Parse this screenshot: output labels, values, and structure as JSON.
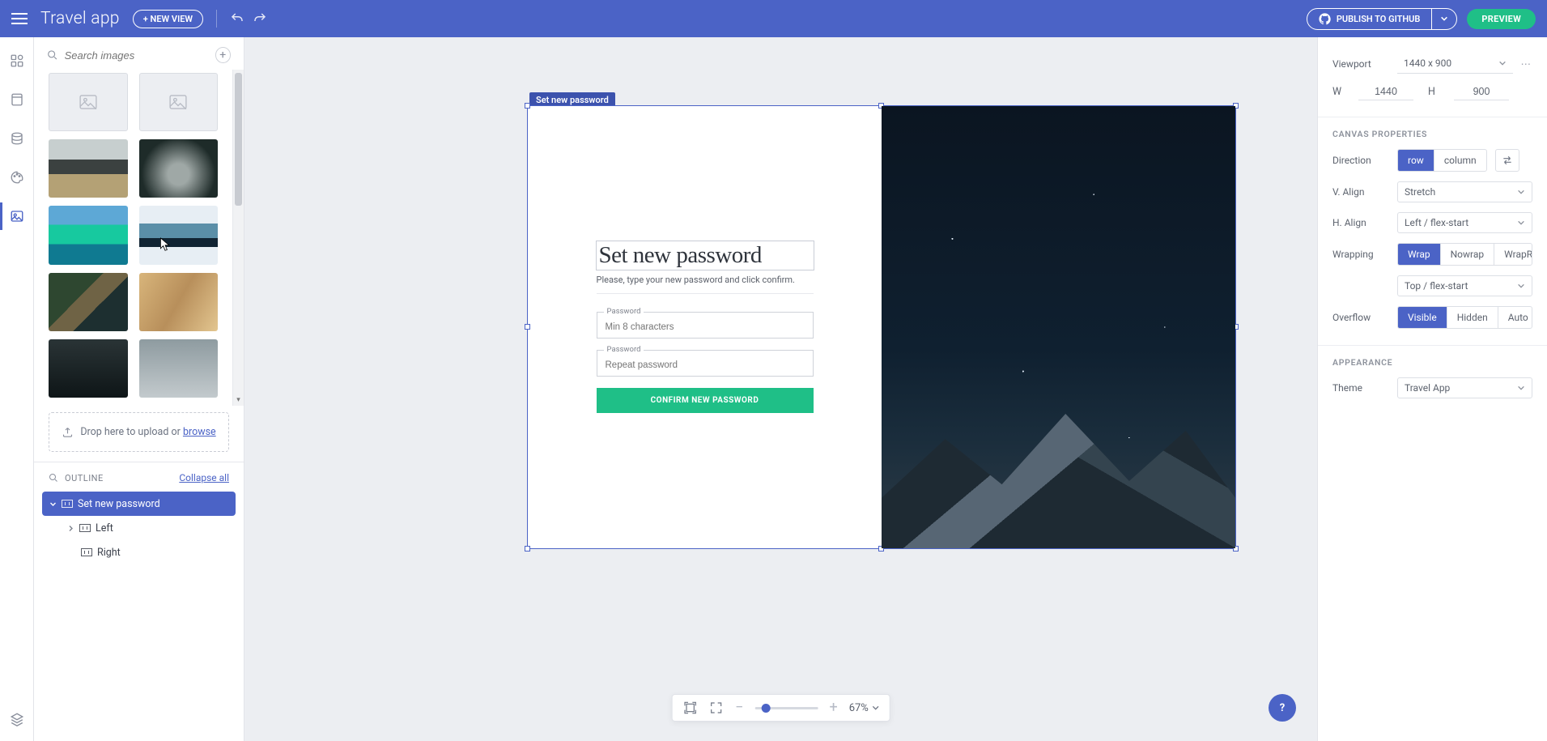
{
  "header": {
    "app_title": "Travel app",
    "new_view": "+ NEW VIEW",
    "publish": "PUBLISH TO GITHUB",
    "preview": "PREVIEW"
  },
  "left": {
    "search_placeholder": "Search images",
    "drop_text": "Drop here to upload or ",
    "drop_link": "browse",
    "outline_label": "OUTLINE",
    "collapse": "Collapse all",
    "tree": {
      "root": "Set new password",
      "child1": "Left",
      "child2": "Right"
    }
  },
  "canvas": {
    "selection_tag": "Set new password",
    "form": {
      "title": "Set new password",
      "subtitle": "Please, type your new password and click confirm.",
      "field1_label": "Password",
      "field1_placeholder": "Min 8 characters",
      "field2_label": "Password",
      "field2_placeholder": "Repeat password",
      "button": "CONFIRM NEW PASSWORD"
    }
  },
  "zoom": {
    "percent": "67%"
  },
  "right": {
    "viewport_label": "Viewport",
    "viewport_value": "1440 x 900",
    "w_label": "W",
    "w_value": "1440",
    "h_label": "H",
    "h_value": "900",
    "section_canvas": "CANVAS PROPERTIES",
    "direction_label": "Direction",
    "direction_row": "row",
    "direction_col": "column",
    "valign_label": "V. Align",
    "valign_value": "Stretch",
    "halign_label": "H. Align",
    "halign_value": "Left / flex-start",
    "wrapping_label": "Wrapping",
    "wrap": "Wrap",
    "nowrap": "Nowrap",
    "wrapre": "WrapRe...",
    "wrap_align": "Top / flex-start",
    "overflow_label": "Overflow",
    "ov_visible": "Visible",
    "ov_hidden": "Hidden",
    "ov_auto": "Auto",
    "section_appearance": "APPEARANCE",
    "theme_label": "Theme",
    "theme_value": "Travel App"
  },
  "help": "?"
}
